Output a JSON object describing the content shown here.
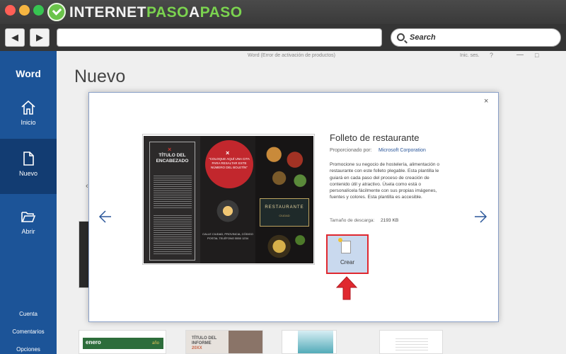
{
  "brand": {
    "part1": "INTERNET",
    "part2": "PASO",
    "part3": "A",
    "part4": "PASO"
  },
  "browser": {
    "back_glyph": "◀",
    "forward_glyph": "▶",
    "search_label": "Search",
    "search_icon": "magnifier-icon"
  },
  "word": {
    "app_name": "Word",
    "window_title": "Word (Error de activación de productos)",
    "signin": "Inic. ses.",
    "help": "?",
    "minimize": "—",
    "maximize": "□",
    "heading": "Nuevo",
    "sidebar": {
      "items": [
        {
          "label": "Inicio",
          "icon": "home-icon"
        },
        {
          "label": "Nuevo",
          "icon": "new-document-icon"
        },
        {
          "label": "Abrir",
          "icon": "open-folder-icon"
        }
      ],
      "bottom": [
        "Cuenta",
        "Comentarios",
        "Opciones"
      ]
    },
    "background": {
      "chevron": "‹",
      "tile_calendar_month": "enero",
      "tile_calendar_year": "año",
      "tile_report_text": "TÍTULO DEL INFORME",
      "tile_report_year": "20XX"
    }
  },
  "dialog": {
    "close": "×",
    "title": "Folleto de restaurante",
    "provider_label": "Proporcionado por:",
    "provider": "Microsoft Corporation",
    "description": "Promocione su negocio de hostelería, alimentación o restaurante con este folleto plegable. Esta plantilla le guiará en cada paso del proceso de creación de contenido útil y atractivo. Úsela como está o personalícela fácilmente con sus propias imágenes, fuentes y colores. Esta plantilla es accesible.",
    "size_label": "Tamaño de descarga:",
    "size_value": "2193 KB",
    "create_label": "Crear",
    "preview": {
      "x_mark": "×",
      "heading": "TÍTULO DEL ENCABEZADO",
      "quote": "\"COLOQUE AQUÍ UNA CITA PARA RESALTAR ESTE NÚMERO DEL BOLETÍN\"",
      "address": "CALLE CIUDAD, PROVINCIA, CÓDIGO POSTAL TELÉFONO 5550 1234",
      "restaurant": "RESTAURANTE",
      "restaurant_sub": "CIUDAD"
    }
  },
  "colors": {
    "word_blue": "#1c5498",
    "word_blue_selected": "#123c72",
    "highlight_red": "#e0282f",
    "brand_green": "#7bd34f"
  }
}
